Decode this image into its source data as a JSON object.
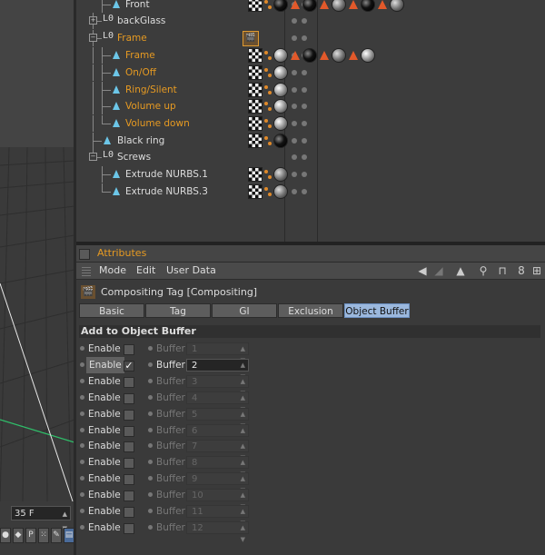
{
  "viewport": {
    "frame_value": "35 F",
    "icons": [
      "record",
      "keyframe",
      "P",
      "dots",
      "pen",
      "compose"
    ]
  },
  "object_manager": {
    "rows": [
      {
        "name": "Front",
        "color": "white",
        "indent": 2,
        "icon": "triangle"
      },
      {
        "name": "backGlass",
        "color": "white",
        "indent": 1,
        "icon": "null",
        "expand": "+"
      },
      {
        "name": "Frame",
        "color": "orange",
        "indent": 1,
        "icon": "null",
        "expand": "-"
      },
      {
        "name": "Frame",
        "color": "orange",
        "indent": 2,
        "icon": "triangle"
      },
      {
        "name": "On/Off",
        "color": "orange",
        "indent": 2,
        "icon": "triangle"
      },
      {
        "name": "Ring/Silent",
        "color": "orange",
        "indent": 2,
        "icon": "triangle"
      },
      {
        "name": "Volume up",
        "color": "orange",
        "indent": 2,
        "icon": "triangle"
      },
      {
        "name": "Volume down",
        "color": "orange",
        "indent": 2,
        "icon": "triangle"
      },
      {
        "name": "Black ring",
        "color": "white",
        "indent": 1,
        "icon": "triangle"
      },
      {
        "name": "Screws",
        "color": "white",
        "indent": 1,
        "icon": "null",
        "expand": "-"
      },
      {
        "name": "Extrude NURBS.1",
        "color": "white",
        "indent": 2,
        "icon": "triangle"
      },
      {
        "name": "Extrude NURBS.3",
        "color": "white",
        "indent": 2,
        "icon": "triangle"
      }
    ]
  },
  "attributes": {
    "header_title": "Attributes",
    "menu": [
      "Mode",
      "Edit",
      "User Data"
    ],
    "object_title": "Compositing Tag [Compositing]",
    "tabs": [
      {
        "label": "Basic",
        "active": false
      },
      {
        "label": "Tag",
        "active": false
      },
      {
        "label": "GI",
        "active": false
      },
      {
        "label": "Exclusion",
        "active": false
      },
      {
        "label": "Object Buffer",
        "active": true
      }
    ],
    "section_title": "Add to Object Buffer",
    "enable_label": "Enable",
    "buffer_label": "Buffer",
    "buffers": [
      {
        "enabled": false,
        "value": "1"
      },
      {
        "enabled": true,
        "value": "2"
      },
      {
        "enabled": false,
        "value": "3"
      },
      {
        "enabled": false,
        "value": "4"
      },
      {
        "enabled": false,
        "value": "5"
      },
      {
        "enabled": false,
        "value": "6"
      },
      {
        "enabled": false,
        "value": "7"
      },
      {
        "enabled": false,
        "value": "8"
      },
      {
        "enabled": false,
        "value": "9"
      },
      {
        "enabled": false,
        "value": "10"
      },
      {
        "enabled": false,
        "value": "11"
      },
      {
        "enabled": false,
        "value": "12"
      }
    ]
  }
}
